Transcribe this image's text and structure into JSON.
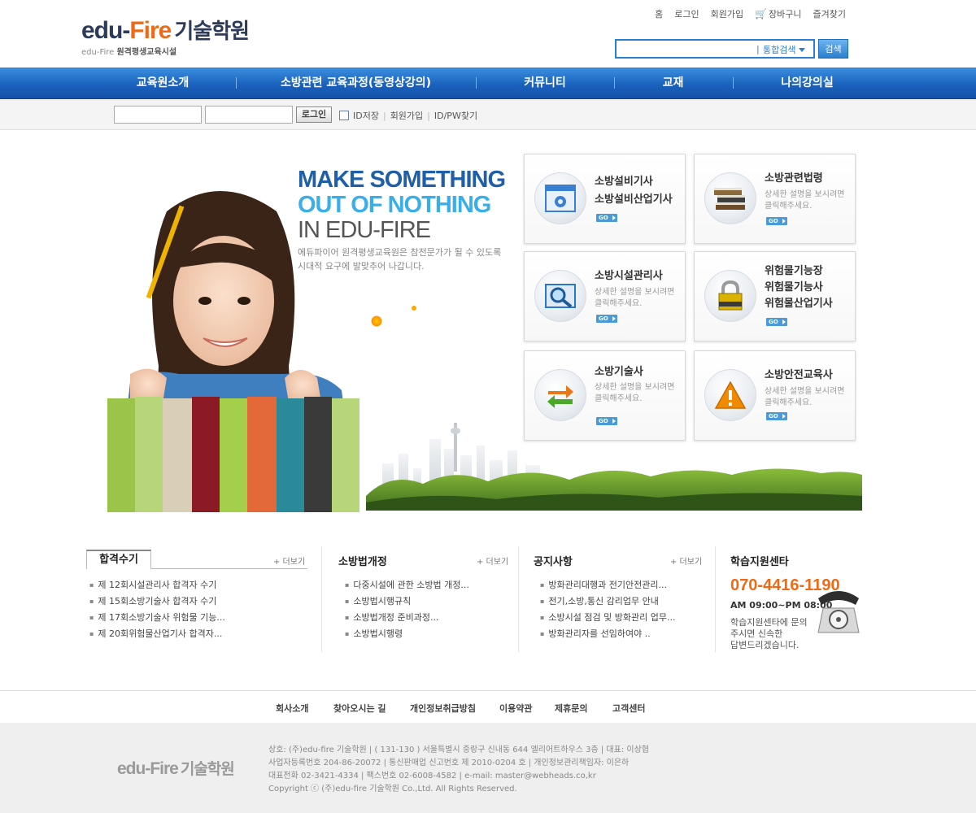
{
  "header": {
    "logo_edu": "edu-",
    "logo_fire": "Fire",
    "logo_kor": "기술학원",
    "logo_sub_en": "edu-Fire",
    "logo_sub_kr": "원격평생교육시설",
    "topnav": [
      "홈",
      "로그인",
      "회원가입",
      "장바구니",
      "즐겨찾기"
    ],
    "search_value": "",
    "search_scope": "통합검색",
    "search_button": "검색"
  },
  "mainnav": [
    "교육원소개",
    "소방관련 교육과정(동영상강의)",
    "커뮤니티",
    "교재",
    "나의강의실"
  ],
  "login": {
    "id_value": "",
    "pw_value": "",
    "button": "로그인",
    "save_id": "ID저장",
    "join": "회원가입",
    "find": "ID/PW찾기"
  },
  "hero": {
    "tag1": "MAKE SOMETHING",
    "tag2": "OUT OF NOTHING",
    "tag3": "IN EDU-FIRE",
    "desc_line1": "에듀파이어 원격평생교육원은 참전문가가 될 수 있도록",
    "desc_line2": "시대적 요구에 발맞추어 나갑니다."
  },
  "cards": [
    {
      "title1": "소방설비기사",
      "title2": "소방설비산업기사",
      "title3": "",
      "desc1": "",
      "desc2": "",
      "go": "GO",
      "icon": "gear-window-icon",
      "color": "#3a7fd1"
    },
    {
      "title1": "소방관련법령",
      "title2": "",
      "title3": "",
      "desc1": "상세한 설명을 보시려면",
      "desc2": "클릭해주세요.",
      "go": "GO",
      "icon": "books-icon",
      "color": "#6b4b2a"
    },
    {
      "title1": "소방시설관리사",
      "title2": "",
      "title3": "",
      "desc1": "상세한 설명을 보시려면",
      "desc2": "클릭해주세요.",
      "go": "GO",
      "icon": "magnifier-icon",
      "color": "#2a78c4"
    },
    {
      "title1": "위험물기능장",
      "title2": "위험물기능사",
      "title3": "위험물산업기사",
      "desc1": "",
      "desc2": "",
      "go": "GO",
      "icon": "lock-icon",
      "color": "#d9b300"
    },
    {
      "title1": "소방기술사",
      "title2": "",
      "title3": "",
      "desc1": "상세한 설명을 보시려면",
      "desc2": "클릭해주세요.",
      "go": "GO",
      "icon": "refresh-arrows-icon",
      "color": "#e9771a"
    },
    {
      "title1": "소방안전교육사",
      "title2": "",
      "title3": "",
      "desc1": "상세한 설명을 보시려면",
      "desc2": "클릭해주세요.",
      "go": "GO",
      "icon": "warning-icon",
      "color": "#f08a00"
    }
  ],
  "boards": {
    "pass": {
      "title": "합격수기",
      "more": "+ 더보기",
      "items": [
        "제 12회시설관리사 합격자 수기",
        "제 15회소방기술사 합격자 수기",
        "제 17회소방기술사 위험물 기능...",
        "제 20회위험물산업기사 합격자..."
      ]
    },
    "law": {
      "title": "소방법개정",
      "more": "+ 더보기",
      "items": [
        "다중시설에 관한 소방법 개정...",
        "소방법시행규칙",
        "소방법개정 준비과정...",
        "소방법시행령"
      ]
    },
    "notice": {
      "title": "공지사항",
      "more": "+ 더보기",
      "items": [
        "방화관리대행과 전기안전관리...",
        "전기,소방,통신 감리업무 안내",
        "소방시설 점검 및 방화관리 업무...",
        "방화관리자를 선임하여야 .."
      ]
    },
    "support": {
      "title": "학습지원센타",
      "phone": "070-4416-1190",
      "hours": "AM 09:00~PM 08:00",
      "desc1": "학습지원센타에 문의",
      "desc2": "주시면 신속한",
      "desc3": "답변드리겠습니다."
    }
  },
  "footnav": [
    "회사소개",
    "찾아오시는 길",
    "개인정보취급방침",
    "이용약관",
    "제휴문의",
    "고객센터"
  ],
  "footer": {
    "logo": "edu-Fire",
    "logo_kor": "기술학원",
    "line1": "상호: (주)edu-fire 기술학원 | ( 131-130 ) 서울특별시 중랑구 신내동 644 엘리어트하우스 3층 | 대표: 이상협",
    "line2": "사업자등록번호 204-86-20072 | 통신판매업 신고번호 제 2010-0204 호 | 개인정보관리책임자: 이은하",
    "line3": "대표전화 02-3421-4334 | 팩스번호 02-6008-4582 | e-mail: master@webheads.co,kr",
    "line4": "Copyright ⓒ (주)edu-fire 기술학원 Co.,Ltd. All Rights Reserved."
  }
}
